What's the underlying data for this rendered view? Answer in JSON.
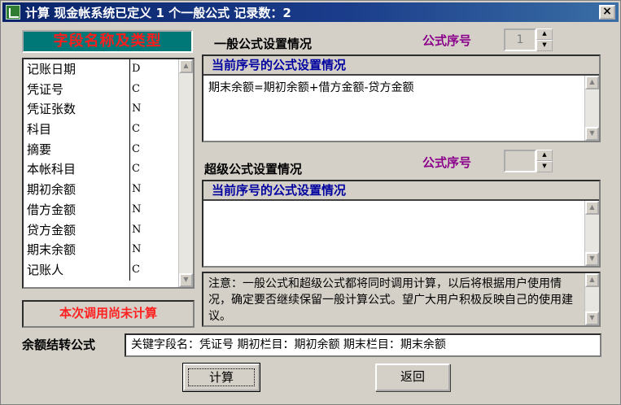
{
  "window": {
    "title": "计算 现金帐系统已定义 1 个一般公式 记录数：2",
    "close_label": "×"
  },
  "fields": {
    "header": "字段名称及类型",
    "items": [
      {
        "name": "记账日期",
        "type": "D"
      },
      {
        "name": "凭证号",
        "type": "C"
      },
      {
        "name": "凭证张数",
        "type": "N"
      },
      {
        "name": "科目",
        "type": "C"
      },
      {
        "name": "摘要",
        "type": "C"
      },
      {
        "name": "本帐科目",
        "type": "C"
      },
      {
        "name": "期初余额",
        "type": "N"
      },
      {
        "name": "借方金额",
        "type": "N"
      },
      {
        "name": "贷方金额",
        "type": "N"
      },
      {
        "name": "期末余额",
        "type": "N"
      },
      {
        "name": "记账人",
        "type": "C"
      }
    ],
    "status": "本次调用尚未计算"
  },
  "general_formula": {
    "title": "一般公式设置情况",
    "seq_label": "公式序号",
    "seq_value": "1",
    "panel_title": "当前序号的公式设置情况",
    "content": "期末余额=期初余额+借方金额-贷方金额"
  },
  "super_formula": {
    "title": "超级公式设置情况",
    "seq_label": "公式序号",
    "seq_value": "",
    "panel_title": "当前序号的公式设置情况",
    "content": ""
  },
  "note": {
    "text": "注意：一般公式和超级公式都将同时调用计算，以后将根据用户使用情况，确定要否继续保留一般计算公式。望广大用户积极反映自己的使用建议。"
  },
  "balance_formula": {
    "label": "余额结转公式",
    "value": "关键字段名：凭证号  期初栏目：期初余额  期末栏目：期末余额"
  },
  "buttons": {
    "calc_label": "计算",
    "back_label": "返回"
  },
  "icons": {
    "arrow_up": "▲",
    "arrow_down": "▼"
  }
}
